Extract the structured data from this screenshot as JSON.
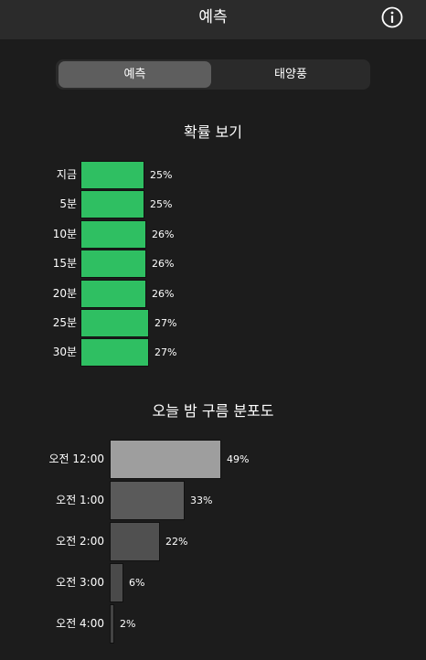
{
  "nav": {
    "title": "예측",
    "info_icon": "info-circle-icon"
  },
  "segmented": {
    "tabs": [
      {
        "label": "예측",
        "active": true
      },
      {
        "label": "태양풍",
        "active": false
      }
    ]
  },
  "probability": {
    "title": "확률 보기",
    "bar_color": "#2fbf62",
    "rows": [
      {
        "label": "지금",
        "value_text": "25%",
        "value": 25
      },
      {
        "label": "5분",
        "value_text": "25%",
        "value": 25
      },
      {
        "label": "10분",
        "value_text": "26%",
        "value": 26
      },
      {
        "label": "15분",
        "value_text": "26%",
        "value": 26
      },
      {
        "label": "20분",
        "value_text": "26%",
        "value": 26
      },
      {
        "label": "25분",
        "value_text": "27%",
        "value": 27
      },
      {
        "label": "30분",
        "value_text": "27%",
        "value": 27
      }
    ]
  },
  "cloud": {
    "title": "오늘 밤 구름 분포도",
    "rows": [
      {
        "label": "오전 12:00",
        "value_text": "49%",
        "value": 49,
        "color": "#9e9e9e"
      },
      {
        "label": "오전 1:00",
        "value_text": "33%",
        "value": 33,
        "color": "#5a5a5a"
      },
      {
        "label": "오전 2:00",
        "value_text": "22%",
        "value": 22,
        "color": "#505050"
      },
      {
        "label": "오전 3:00",
        "value_text": "6%",
        "value": 6,
        "color": "#4a4a4a"
      },
      {
        "label": "오전 4:00",
        "value_text": "2%",
        "value": 2,
        "color": "#444444"
      }
    ]
  }
}
